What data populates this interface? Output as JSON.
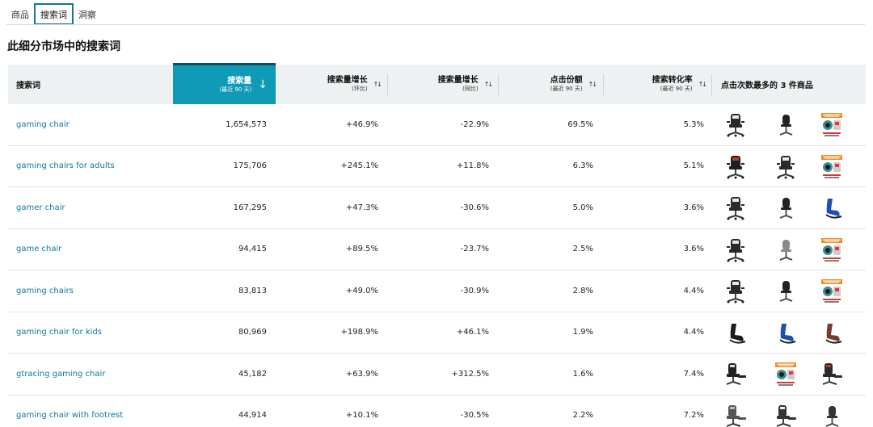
{
  "tabs": [
    {
      "label": "商品",
      "active": false
    },
    {
      "label": "搜索词",
      "active": true
    },
    {
      "label": "洞察",
      "active": false
    }
  ],
  "section_title": "此细分市场中的搜索词",
  "table": {
    "headers": {
      "keyword": "搜索词",
      "volume": {
        "label": "搜索量",
        "sub": "(最近 90 天)"
      },
      "growth_qoq": {
        "label": "搜索量增长",
        "sub": "(环比)"
      },
      "growth_yoy": {
        "label": "搜索量增长",
        "sub": "(同比)"
      },
      "click_share": {
        "label": "点击份额",
        "sub": "(最近 90 天)"
      },
      "conversion": {
        "label": "搜索转化率",
        "sub": "(最近 90 天)"
      },
      "top_products": "点击次数最多的 3 件商品"
    },
    "active_sort": "volume",
    "colors": {
      "accent": "#0f9ab6",
      "link": "#0d7a99",
      "header_bg": "#eef1f2"
    },
    "rows": [
      {
        "keyword": "gaming chair",
        "volume": "1,654,573",
        "growth_qoq": "+46.9%",
        "growth_yoy": "-22.9%",
        "click_share": "69.5%",
        "conversion": "5.3%",
        "products": [
          "gaming-chair-white-black",
          "office-chair-black",
          "gaming-chair-bundle-pack"
        ]
      },
      {
        "keyword": "gaming chairs for adults",
        "volume": "175,706",
        "growth_qoq": "+245.1%",
        "growth_yoy": "+11.8%",
        "click_share": "6.3%",
        "conversion": "5.1%",
        "products": [
          "gaming-chair-red-black",
          "gaming-chair-white-black",
          "gaming-chair-bundle-pack"
        ]
      },
      {
        "keyword": "gamer chair",
        "volume": "167,295",
        "growth_qoq": "+47.3%",
        "growth_yoy": "-30.6%",
        "click_share": "5.0%",
        "conversion": "3.6%",
        "products": [
          "gaming-chair-white-black",
          "office-chair-black",
          "floor-rocker-chair-blue"
        ]
      },
      {
        "keyword": "game chair",
        "volume": "94,415",
        "growth_qoq": "+89.5%",
        "growth_yoy": "-23.7%",
        "click_share": "2.5%",
        "conversion": "3.6%",
        "products": [
          "gaming-chair-white-black",
          "office-chair-gray",
          "gaming-chair-bundle-pack"
        ]
      },
      {
        "keyword": "gaming chairs",
        "volume": "83,813",
        "growth_qoq": "+49.0%",
        "growth_yoy": "-30.9%",
        "click_share": "2.8%",
        "conversion": "4.4%",
        "products": [
          "gaming-chair-white-black",
          "office-chair-black",
          "gaming-chair-bundle-pack"
        ]
      },
      {
        "keyword": "gaming chair for kids",
        "volume": "80,969",
        "growth_qoq": "+198.9%",
        "growth_yoy": "+46.1%",
        "click_share": "1.9%",
        "conversion": "4.4%",
        "products": [
          "floor-rocker-chair-black",
          "floor-rocker-chair-blue",
          "floor-rocker-chair-brown"
        ]
      },
      {
        "keyword": "gtracing gaming chair",
        "volume": "45,182",
        "growth_qoq": "+63.9%",
        "growth_yoy": "+312.5%",
        "click_share": "1.6%",
        "conversion": "7.4%",
        "products": [
          "gaming-chair-footrest-black",
          "gaming-chair-bundle-pack",
          "gaming-chair-footrest-red"
        ]
      },
      {
        "keyword": "gaming chair with footrest",
        "volume": "44,914",
        "growth_qoq": "+10.1%",
        "growth_yoy": "-30.5%",
        "click_share": "2.2%",
        "conversion": "7.2%",
        "products": [
          "gaming-chair-footrest-gray",
          "gaming-chair-footrest-white",
          "office-chair-dark"
        ]
      }
    ]
  }
}
